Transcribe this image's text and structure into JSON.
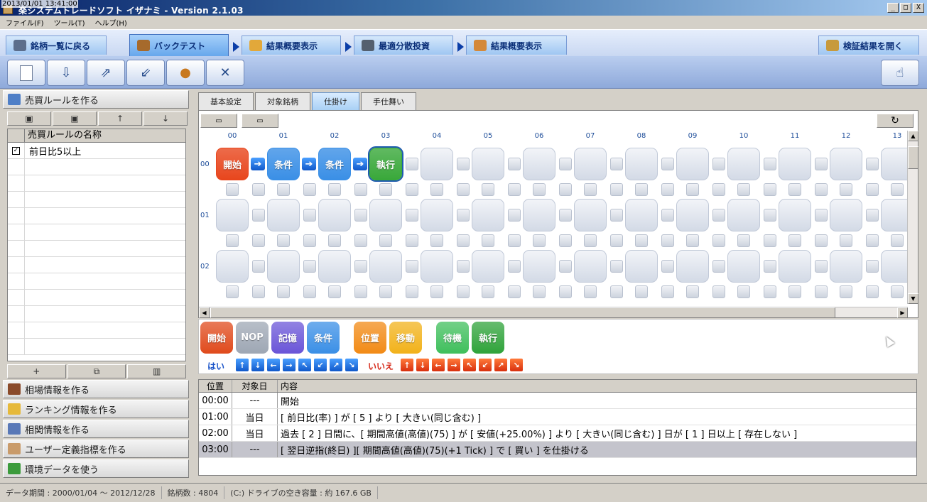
{
  "window": {
    "timestamp": "2013/01/01 13:41:00",
    "title": "楽システムトレードソフト イザナミ - Version 2.1.03",
    "min": "_",
    "max": "□",
    "close": "X"
  },
  "menu": [
    "ファイル(F)",
    "ツール(T)",
    "ヘルプ(H)"
  ],
  "nav": {
    "back": "銘柄一覧に戻る",
    "backtest": "バックテスト",
    "summary1": "結果概要表示",
    "optimize": "最適分散投資",
    "summary2": "結果概要表示",
    "open": "検証結果を開く"
  },
  "toolbar": {
    "icons": [
      "new-file-icon",
      "import-icon",
      "export-icon",
      "copy-icon",
      "palette-icon",
      "tools-icon",
      "hand-icon"
    ]
  },
  "left": {
    "make_rule": "売買ルールを作る",
    "list_header": "売買ルールの名称",
    "rules": [
      {
        "checked": true,
        "name": "前日比5以上"
      }
    ],
    "sections": [
      "相場情報を作る",
      "ランキング情報を作る",
      "相関情報を作る",
      "ユーザー定義指標を作る",
      "環境データを使う"
    ]
  },
  "tabs": [
    "基本設定",
    "対象銘柄",
    "仕掛け",
    "手仕舞い"
  ],
  "grid": {
    "cols": [
      "00",
      "01",
      "02",
      "03",
      "04",
      "05",
      "06",
      "07",
      "08",
      "09",
      "10",
      "11",
      "12",
      "13"
    ],
    "rows": [
      "00",
      "01",
      "02"
    ],
    "blocks": [
      {
        "label": "開始",
        "color": "#e8461d"
      },
      {
        "label": "条件",
        "color": "#3a8fe6"
      },
      {
        "label": "条件",
        "color": "#3a8fe6"
      },
      {
        "label": "執行",
        "color": "#39a83a"
      }
    ]
  },
  "palette": {
    "blocks": [
      {
        "label": "開始",
        "color": "#e04a1c"
      },
      {
        "label": "NOP",
        "color": "#9ea7b4"
      },
      {
        "label": "記憶",
        "color": "#6a55d8"
      },
      {
        "label": "条件",
        "color": "#3a8fe6"
      },
      {
        "label": "位置",
        "color": "#f28a15"
      },
      {
        "label": "移動",
        "color": "#f2b21a"
      },
      {
        "label": "待機",
        "color": "#3fbf5c"
      },
      {
        "label": "執行",
        "color": "#2fa33a"
      }
    ],
    "yes": "はい",
    "no": "いいえ"
  },
  "steps": {
    "headers": [
      "位置",
      "対象日",
      "内容"
    ],
    "rows": [
      [
        "00:00",
        "---",
        "開始"
      ],
      [
        "01:00",
        "当日",
        "[ 前日比(率) ] が [ 5 ] より [ 大きい(同じ含む) ]"
      ],
      [
        "02:00",
        "当日",
        "過去 [ 2 ] 日間に、[ 期間高値(高値)(75) ] が [ 安値(+25.00%) ] より [ 大きい(同じ含む) ] 日が [ 1 ] 日以上 [ 存在しない ]"
      ],
      [
        "03:00",
        "---",
        "[ 翌日逆指(終日) ][ 期間高値(高値)(75)(+1 Tick) ] で [ 買い ] を仕掛ける"
      ]
    ]
  },
  "status": {
    "period": "データ期間 : 2000/01/04 〜 2012/12/28",
    "count": "銘柄数 : 4804",
    "disk": "(C:) ドライブの空き容量 : 約 167.6 GB"
  }
}
